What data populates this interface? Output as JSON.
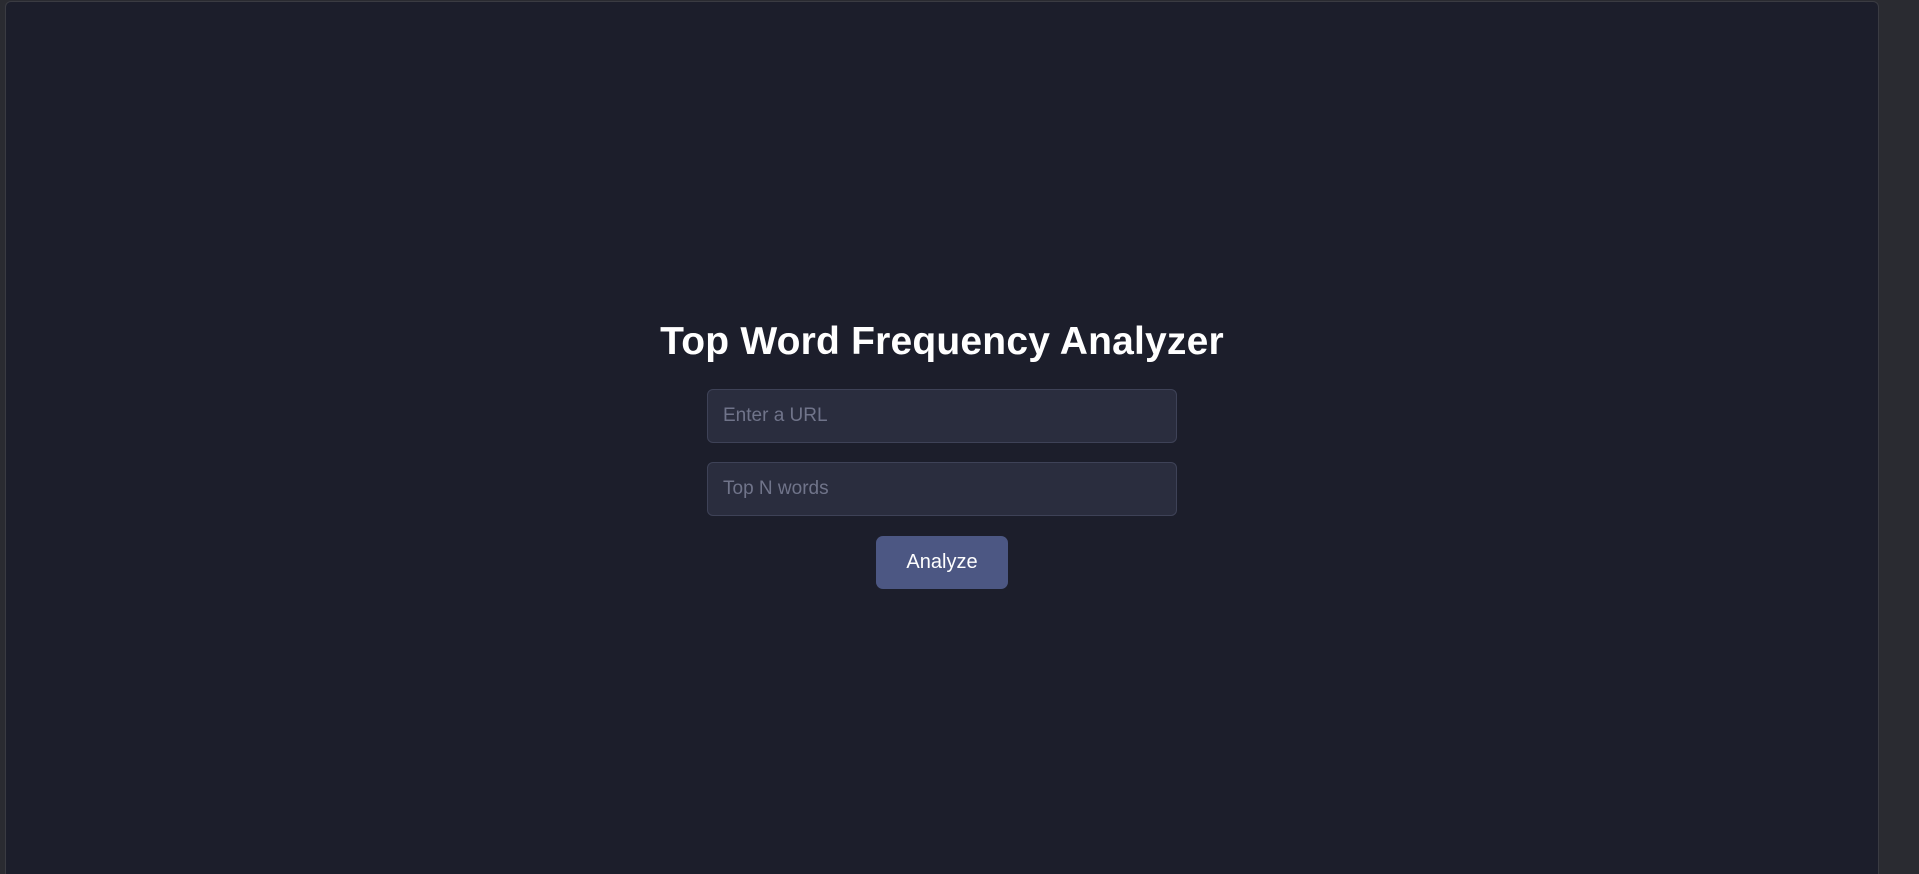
{
  "page": {
    "title": "Top Word Frequency Analyzer"
  },
  "form": {
    "url_input": {
      "value": "",
      "placeholder": "Enter a URL"
    },
    "top_n_input": {
      "value": "",
      "placeholder": "Top N words"
    },
    "analyze_label": "Analyze"
  },
  "colors": {
    "background": "#1c1e2b",
    "input_background": "#2a2d3e",
    "button": "#4c5783",
    "title_text": "#ffffff"
  }
}
